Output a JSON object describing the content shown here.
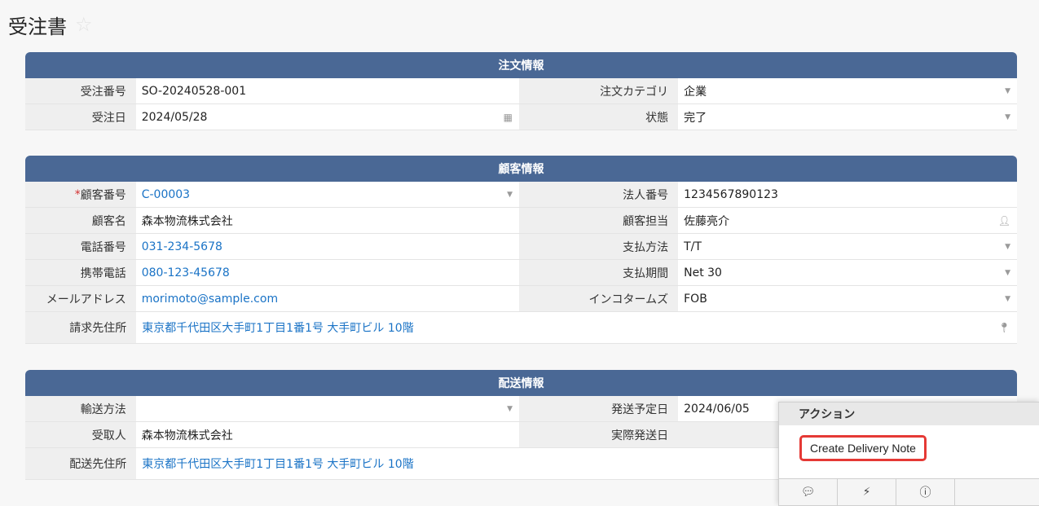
{
  "page": {
    "title": "受注書"
  },
  "order_info": {
    "header": "注文情報",
    "order_no_label": "受注番号",
    "order_no": "SO-20240528-001",
    "category_label": "注文カテゴリ",
    "category": "企業",
    "order_date_label": "受注日",
    "order_date": "2024/05/28",
    "status_label": "状態",
    "status": "完了"
  },
  "customer_info": {
    "header": "顧客情報",
    "required_mark": "*",
    "customer_no_label": "顧客番号",
    "customer_no": "C-00003",
    "corp_no_label": "法人番号",
    "corp_no": "1234567890123",
    "customer_name_label": "顧客名",
    "customer_name": "森本物流株式会社",
    "contact_label": "顧客担当",
    "contact": "佐藤亮介",
    "phone_label": "電話番号",
    "phone": "031-234-5678",
    "payment_method_label": "支払方法",
    "payment_method": "T/T",
    "mobile_label": "携帯電話",
    "mobile": "080-123-45678",
    "payment_term_label": "支払期間",
    "payment_term": "Net 30",
    "email_label": "メールアドレス",
    "email": "morimoto@sample.com",
    "incoterms_label": "インコタームズ",
    "incoterms": "FOB",
    "billing_address_label": "請求先住所",
    "billing_address": "東京都千代田区大手町1丁目1番1号 大手町ビル 10階"
  },
  "shipping_info": {
    "header": "配送情報",
    "transport_label": "輸送方法",
    "transport": "",
    "ship_plan_label": "発送予定日",
    "ship_plan": "2024/06/05",
    "recipient_label": "受取人",
    "recipient": "森本物流株式会社",
    "actual_ship_label": "実際発送日",
    "actual_ship": "",
    "delivery_address_label": "配送先住所",
    "delivery_address": "東京都千代田区大手町1丁目1番1号 大手町ビル 10階"
  },
  "actions_panel": {
    "header": "アクション",
    "create_delivery_note": "Create Delivery Note",
    "footer_icons": [
      "comment-icon",
      "bolt-icon",
      "info-icon"
    ]
  }
}
